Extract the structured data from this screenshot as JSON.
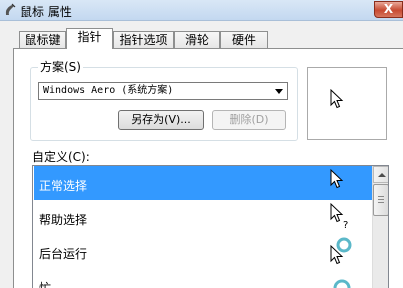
{
  "window": {
    "title": "鼠标 属性",
    "close_label": "X"
  },
  "tabs": [
    {
      "label": "鼠标键"
    },
    {
      "label": "指针"
    },
    {
      "label": "指针选项"
    },
    {
      "label": "滑轮"
    },
    {
      "label": "硬件"
    }
  ],
  "active_tab": "指针",
  "scheme": {
    "label": "方案(S)",
    "selected": "Windows Aero (系统方案)",
    "save_as_label": "另存为(V)...",
    "delete_label": "删除(D)"
  },
  "custom": {
    "label": "自定义(C):",
    "items": [
      {
        "label": "正常选择",
        "cursor_icon": "arrow-cursor-icon",
        "selected": true
      },
      {
        "label": "帮助选择",
        "cursor_icon": "help-cursor-icon",
        "selected": false
      },
      {
        "label": "后台运行",
        "cursor_icon": "working-in-background-cursor-icon",
        "selected": false
      },
      {
        "label": "忙",
        "cursor_icon": "busy-cursor-icon",
        "selected": false
      }
    ]
  },
  "colors": {
    "selection": "#3399ff",
    "busy_ring": "#5bb8c9"
  }
}
